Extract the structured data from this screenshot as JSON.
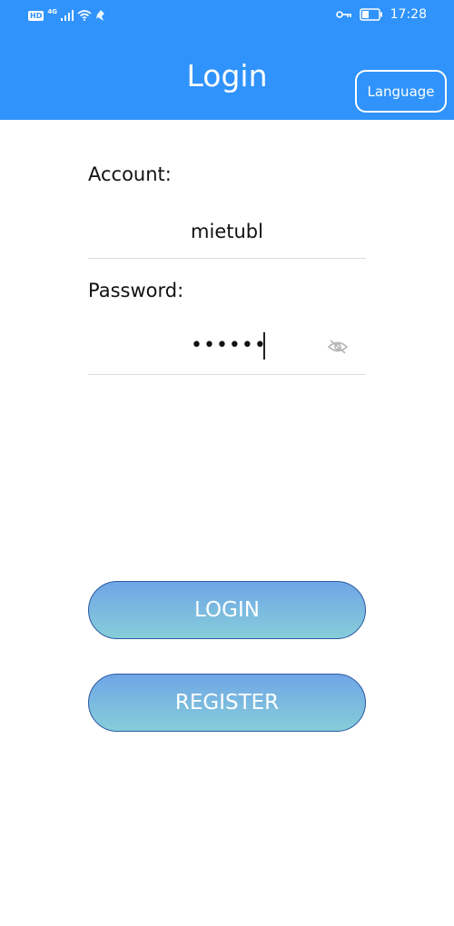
{
  "status_bar": {
    "hd_badge": "HD",
    "network_type": "4G",
    "time": "17:28"
  },
  "header": {
    "title": "Login",
    "language_label": "Language",
    "background_color": "#2f93fb"
  },
  "form": {
    "account_label": "Account:",
    "account_value": "mietubl",
    "password_label": "Password:",
    "password_masked": "••••••"
  },
  "buttons": {
    "login_label": "LOGIN",
    "register_label": "REGISTER"
  },
  "icons": {
    "status": [
      "hd-badge",
      "signal-icon",
      "wifi-icon",
      "notification-icon",
      "key-icon",
      "battery-icon"
    ],
    "password_toggle": "eye-hidden-icon"
  }
}
